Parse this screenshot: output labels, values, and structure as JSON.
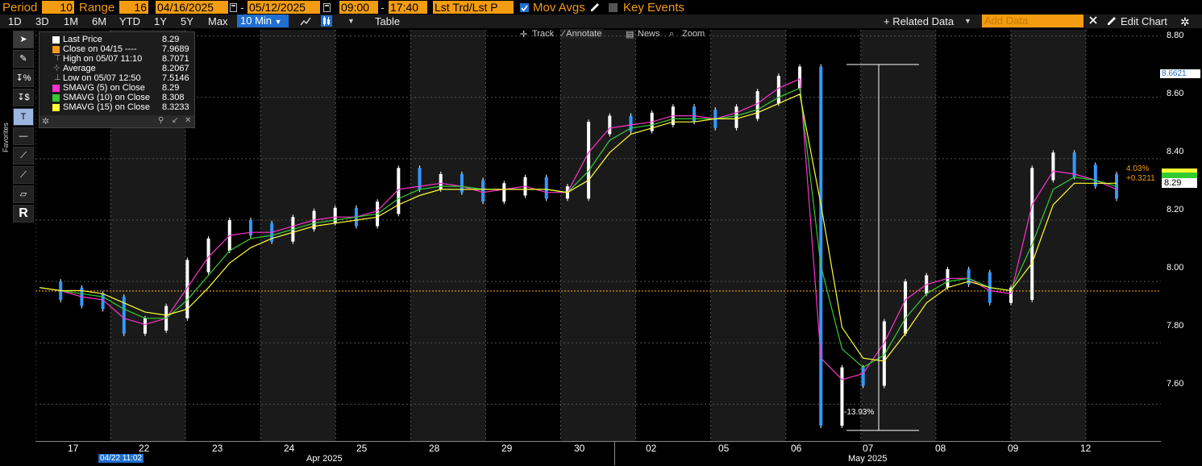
{
  "toolbar": {
    "period_label": "Period",
    "period_value": "10",
    "range_label": "Range",
    "range_value": "16",
    "start_date": "04/16/2025",
    "end_date": "05/12/2025",
    "start_time": "09:00",
    "end_time": "17:40",
    "price_type": "Lst Trd/Lst P",
    "mov_avgs": "Mov Avgs",
    "key_events": "Key Events",
    "date_sep": "-",
    "time_sep": "-"
  },
  "timeframes": [
    "1D",
    "3D",
    "1M",
    "6M",
    "YTD",
    "1Y",
    "5Y",
    "Max"
  ],
  "interval_label": "10 Min",
  "table_label": "Table",
  "related_data": "+ Related Data",
  "add_data_placeholder": "Add Data",
  "edit_chart": "Edit Chart",
  "annot_tools": [
    "Track",
    "Annotate",
    "News",
    "Zoom"
  ],
  "favorites_label": "Favorites",
  "legend": [
    {
      "label": "Last Price",
      "value": "8.29",
      "color": "#ffffff"
    },
    {
      "label": "Close on 04/15 ----",
      "value": "7.9689",
      "color": "#f39c12"
    },
    {
      "label": "High on 05/07 11:10",
      "value": "8.7071",
      "color": ""
    },
    {
      "label": "Average",
      "value": "8.2067",
      "color": ""
    },
    {
      "label": "Low on 05/07 12:50",
      "value": "7.5146",
      "color": ""
    },
    {
      "label": "SMAVG (5)  on Close",
      "value": "8.29",
      "color": "#ff33cc"
    },
    {
      "label": "SMAVG (10)  on Close",
      "value": "8.308",
      "color": "#33cc33"
    },
    {
      "label": "SMAVG (15)  on Close",
      "value": "8.3233",
      "color": "#ffff33"
    }
  ],
  "axis_labels": {
    "y_ticks": [
      "8.80",
      "8.60",
      "8.40",
      "8.20",
      "8.00",
      "7.80",
      "7.60"
    ],
    "x_days": [
      "17",
      "22",
      "23",
      "24",
      "25",
      "28",
      "29",
      "30",
      "02",
      "05",
      "06",
      "07",
      "08",
      "09",
      "12"
    ],
    "months": [
      "Apr 2025",
      "May 2025"
    ],
    "cursor_date": "04/22 11:02",
    "high_marker": "8.6621",
    "pct_change": "4.03%",
    "abs_change": "+0.3211",
    "last_tag": "8.29",
    "drawdown": "-13.93%"
  },
  "chart_data": {
    "type": "line",
    "ylim": [
      7.48,
      8.82
    ],
    "reference_close": 7.9689,
    "series": [
      {
        "name": "Last Price",
        "color": "#ffffff",
        "values": [
          7.98,
          7.96,
          7.94,
          7.93,
          7.85,
          7.86,
          7.9,
          8.05,
          8.12,
          8.18,
          8.17,
          8.15,
          8.19,
          8.21,
          8.22,
          8.2,
          8.24,
          8.35,
          8.32,
          8.33,
          8.31,
          8.28,
          8.3,
          8.32,
          8.29,
          8.29,
          8.5,
          8.52,
          8.51,
          8.53,
          8.55,
          8.54,
          8.52,
          8.55,
          8.6,
          8.65,
          8.68,
          7.55,
          7.7,
          7.68,
          7.85,
          7.98,
          8.0,
          8.02,
          8.01,
          7.95,
          7.96,
          8.35,
          8.4,
          8.36,
          8.33,
          8.29
        ]
      },
      {
        "name": "SMAVG (5)  on Close",
        "color": "#ff33cc",
        "values": [
          7.98,
          7.97,
          7.95,
          7.94,
          7.88,
          7.86,
          7.88,
          7.98,
          8.08,
          8.15,
          8.16,
          8.16,
          8.18,
          8.2,
          8.21,
          8.21,
          8.23,
          8.3,
          8.31,
          8.32,
          8.31,
          8.29,
          8.3,
          8.31,
          8.29,
          8.29,
          8.42,
          8.5,
          8.51,
          8.52,
          8.54,
          8.54,
          8.53,
          8.55,
          8.58,
          8.63,
          8.66,
          7.75,
          7.68,
          7.7,
          7.8,
          7.94,
          7.99,
          8.01,
          8.01,
          7.97,
          7.96,
          8.25,
          8.36,
          8.35,
          8.33,
          8.3
        ]
      },
      {
        "name": "SMAVG (10)  on Close",
        "color": "#33cc33",
        "values": [
          7.98,
          7.97,
          7.96,
          7.95,
          7.91,
          7.88,
          7.88,
          7.94,
          8.02,
          8.1,
          8.14,
          8.15,
          8.17,
          8.19,
          8.2,
          8.21,
          8.22,
          8.27,
          8.3,
          8.31,
          8.31,
          8.3,
          8.3,
          8.3,
          8.3,
          8.29,
          8.36,
          8.46,
          8.5,
          8.51,
          8.53,
          8.53,
          8.53,
          8.54,
          8.56,
          8.6,
          8.63,
          8.05,
          7.78,
          7.72,
          7.76,
          7.88,
          7.96,
          8.0,
          8.01,
          7.98,
          7.97,
          8.12,
          8.3,
          8.34,
          8.33,
          8.31
        ]
      },
      {
        "name": "SMAVG (15)  on Close",
        "color": "#ffff33",
        "values": [
          7.98,
          7.97,
          7.97,
          7.96,
          7.93,
          7.9,
          7.89,
          7.91,
          7.98,
          8.06,
          8.11,
          8.14,
          8.16,
          8.18,
          8.19,
          8.2,
          8.21,
          8.25,
          8.28,
          8.3,
          8.3,
          8.3,
          8.3,
          8.3,
          8.3,
          8.29,
          8.33,
          8.42,
          8.48,
          8.5,
          8.52,
          8.52,
          8.53,
          8.53,
          8.55,
          8.58,
          8.61,
          8.25,
          7.85,
          7.75,
          7.74,
          7.83,
          7.93,
          7.98,
          8.0,
          7.98,
          7.97,
          8.06,
          8.25,
          8.32,
          8.32,
          8.32
        ]
      }
    ]
  }
}
